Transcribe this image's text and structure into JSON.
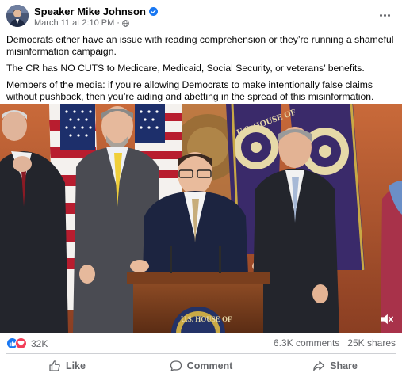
{
  "post": {
    "author": "Speaker Mike Johnson",
    "timestamp": "March 11 at 2:10 PM",
    "separator": "·",
    "paragraphs": [
      "Democrats either have an issue with reading comprehension or they’re running a shameful misinformation campaign.",
      "The CR has NO CUTS to Medicare, Medicaid, Social Security, or veterans’ benefits.",
      "Members of the media: if you’re allowing Democrats to make intentionally false claims without pushback, then you’re aiding and abetting in the spread of this misinformation."
    ]
  },
  "media": {
    "banner_text": "U.S. HOUSE OF",
    "podium_text": "U.S. HOUSE OF"
  },
  "stats": {
    "reaction_count": "32K",
    "comments": "6.3K comments",
    "shares": "25K shares"
  },
  "actions": {
    "like": "Like",
    "comment": "Comment",
    "share": "Share"
  },
  "colors": {
    "brand_blue": "#1877f2",
    "love_red": "#f33e58",
    "muted_text": "#65676b"
  },
  "icons": [
    "verified-badge-icon",
    "globe-icon",
    "more-options-icon",
    "like-reaction-icon",
    "love-reaction-icon",
    "mute-icon",
    "like-icon",
    "comment-icon",
    "share-icon"
  ]
}
